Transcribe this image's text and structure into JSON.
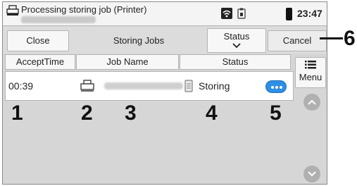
{
  "status_bar": {
    "title": "Processing storing job (Printer)",
    "time": "23:47"
  },
  "toolbar": {
    "close_label": "Close",
    "storing_jobs_label": "Storing Jobs",
    "status_label": "Status",
    "cancel_label": "Cancel"
  },
  "columns": {
    "accept_time": "AcceptTime",
    "job_name": "Job Name",
    "status": "Status"
  },
  "job": {
    "accept_time": "00:39",
    "status": "Storing"
  },
  "menu": {
    "label": "Menu"
  },
  "callouts": {
    "c1": "1",
    "c2": "2",
    "c3": "3",
    "c4": "4",
    "c5": "5",
    "c6": "6"
  },
  "colors": {
    "accent": "#2f8fe6",
    "panel": "#d6d6d6"
  }
}
